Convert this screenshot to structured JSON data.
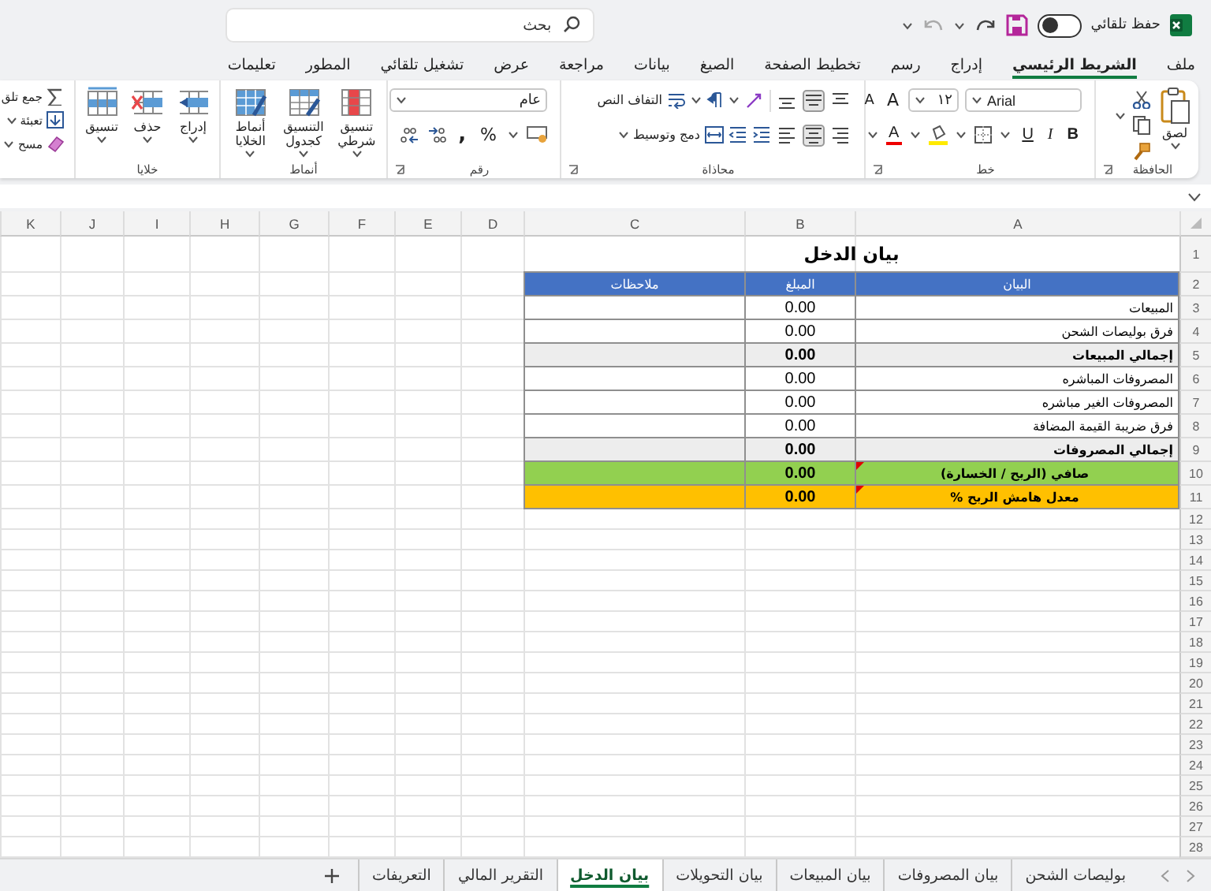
{
  "title_bar": {
    "autosave_label": "حفظ تلقائي",
    "autosave_on": false,
    "undo": {
      "disabled": true
    },
    "redo": {
      "disabled": false
    },
    "search": {
      "placeholder": "بحث"
    }
  },
  "menu_tabs": [
    {
      "label": "ملف",
      "selected": false
    },
    {
      "label": "الشريط الرئيسي",
      "selected": true
    },
    {
      "label": "إدراج",
      "selected": false
    },
    {
      "label": "رسم",
      "selected": false
    },
    {
      "label": "تخطيط الصفحة",
      "selected": false
    },
    {
      "label": "الصيغ",
      "selected": false
    },
    {
      "label": "بيانات",
      "selected": false
    },
    {
      "label": "مراجعة",
      "selected": false
    },
    {
      "label": "عرض",
      "selected": false
    },
    {
      "label": "تشغيل تلقائي",
      "selected": false
    },
    {
      "label": "المطور",
      "selected": false
    },
    {
      "label": "تعليمات",
      "selected": false
    }
  ],
  "ribbon": [
    {
      "kind": "clipboard",
      "label": "الحافظة",
      "paste": "لصق"
    },
    {
      "kind": "font",
      "label": "خط",
      "font_name": "Arial",
      "font_size": "١٢",
      "grow": "A",
      "shrink": "A",
      "bold": "B",
      "italic": "I",
      "underline": "U",
      "font_color": "A"
    },
    {
      "kind": "alignment",
      "label": "محاذاة",
      "vertical": [
        {
          "kind": "top",
          "selected": false
        },
        {
          "kind": "middle",
          "selected": true
        },
        {
          "kind": "bottom",
          "selected": false
        }
      ],
      "horizontal": [
        {
          "kind": "right",
          "selected": false
        },
        {
          "kind": "center",
          "selected": true
        },
        {
          "kind": "left",
          "selected": false
        }
      ],
      "wrap_text": "التفاف النص",
      "merge": "دمج وتوسيط"
    },
    {
      "kind": "number",
      "label": "رقم",
      "format": "عام",
      "percent": "%",
      "comma": ","
    },
    {
      "kind": "styles",
      "label": "أنماط",
      "items": [
        {
          "kind": "conditional",
          "label": "تنسيق شرطي"
        },
        {
          "kind": "table",
          "label": "التنسيق كجدول"
        },
        {
          "kind": "cell_styles",
          "label": "أنماط الخلايا"
        }
      ]
    },
    {
      "kind": "cells",
      "label": "خلايا",
      "items": [
        {
          "kind": "insert",
          "label": "إدراج"
        },
        {
          "kind": "delete",
          "label": "حذف"
        },
        {
          "kind": "format",
          "label": "تنسيق"
        }
      ]
    },
    {
      "kind": "editing",
      "items": [
        {
          "kind": "autosum",
          "label": "جمع تلق"
        },
        {
          "kind": "fill",
          "label": "تعبئة"
        },
        {
          "kind": "clear",
          "label": "مسح"
        }
      ]
    }
  ],
  "sheet": {
    "columns": [
      "A",
      "B",
      "C",
      "D",
      "E",
      "F",
      "G",
      "H",
      "I",
      "J",
      "K"
    ],
    "rows": [
      "1",
      "2",
      "3",
      "4",
      "5",
      "6",
      "7",
      "8",
      "9",
      "10",
      "11",
      "12",
      "13",
      "14",
      "15",
      "16",
      "17",
      "18",
      "19",
      "20",
      "21",
      "22",
      "23",
      "24",
      "25",
      "26",
      "27",
      "28"
    ],
    "title": "بيان الدخل",
    "table": {
      "headers": [
        "البيان",
        "المبلغ",
        "ملاحظات"
      ],
      "rows": [
        {
          "kind": "item",
          "label": "المبيعات",
          "amount": "0.00",
          "comment": false
        },
        {
          "kind": "item",
          "label": "فرق بوليصات الشحن",
          "amount": "0.00",
          "comment": false
        },
        {
          "kind": "total",
          "label": "إجمالي المبيعات",
          "amount": "0.00",
          "comment": false
        },
        {
          "kind": "item",
          "label": "المصروفات المباشره",
          "amount": "0.00",
          "comment": false
        },
        {
          "kind": "item",
          "label": "المصروفات الغير مباشره",
          "amount": "0.00",
          "comment": false
        },
        {
          "kind": "item",
          "label": "فرق ضريبة القيمة المضافة",
          "amount": "0.00",
          "comment": false
        },
        {
          "kind": "total",
          "label": "إجمالي المصروفات",
          "amount": "0.00",
          "comment": false
        },
        {
          "kind": "net",
          "label": "صافي (الربح / الخسارة)",
          "amount": "0.00",
          "comment": true
        },
        {
          "kind": "margin",
          "label": "معدل هامش الربح %",
          "amount": "0.00",
          "comment": true
        }
      ]
    }
  },
  "sheet_tabs": [
    {
      "label": "بوليصات الشحن",
      "selected": false
    },
    {
      "label": "بيان المصروفات",
      "selected": false
    },
    {
      "label": "بيان المبيعات",
      "selected": false
    },
    {
      "label": "بيان التحويلات",
      "selected": false
    },
    {
      "label": "بيان الدخل",
      "selected": true
    },
    {
      "label": "التقرير المالي",
      "selected": false
    },
    {
      "label": "التعريفات",
      "selected": false
    }
  ]
}
